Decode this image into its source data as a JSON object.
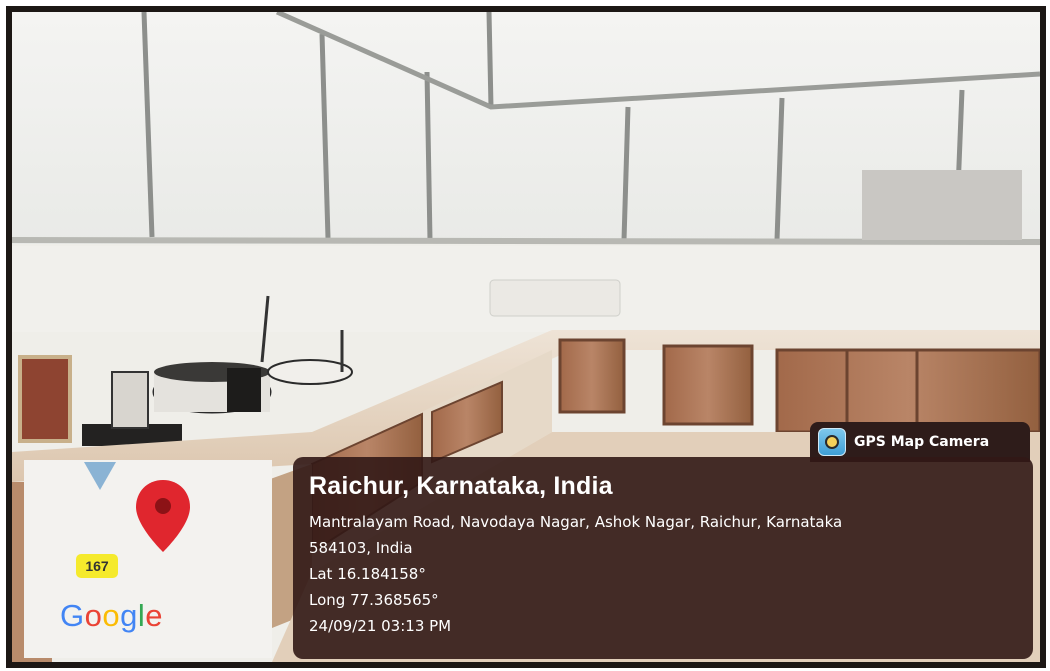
{
  "overlay": {
    "app_name": "GPS Map Camera",
    "city": "Raichur, Karnataka, India",
    "address_line1": "Mantralayam Road, Navodaya Nagar, Ashok Nagar, Raichur, Karnataka",
    "address_line2": "584103, India",
    "latitude": "Lat 16.184158°",
    "longitude": "Long 77.368565°",
    "datetime": "24/09/21 03:13 PM"
  },
  "map": {
    "road_number": "167",
    "brand": [
      "G",
      "o",
      "o",
      "g",
      "l",
      "e"
    ],
    "brand_colors": [
      "#4285F4",
      "#EA4335",
      "#FBBC05",
      "#4285F4",
      "#34A853",
      "#EA4335"
    ],
    "pin_color": "#E0262E",
    "icons": [
      "location-pin-icon",
      "direction-arrow-icon"
    ]
  },
  "colors": {
    "card_bg": "#321816",
    "frame": "#1c1714",
    "cabinet_wood": "#9b6a4c",
    "counter": "#e6d6c3"
  }
}
